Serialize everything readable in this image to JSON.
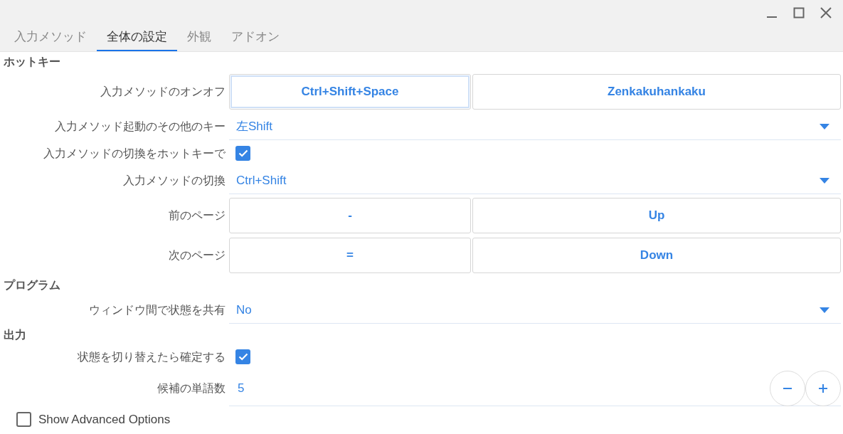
{
  "tabs": [
    {
      "label": "入力メソッド",
      "selected": false
    },
    {
      "label": "全体の設定",
      "selected": true
    },
    {
      "label": "外観",
      "selected": false
    },
    {
      "label": "アドオン",
      "selected": false
    }
  ],
  "sections": [
    {
      "title": "ホットキー",
      "rows": [
        {
          "kind": "keys",
          "label": "入力メソッドのオンオフ",
          "keys": [
            {
              "text": "Ctrl+Shift+Space",
              "focused": true
            },
            {
              "text": "Zenkakuhankaku",
              "focused": false
            }
          ]
        },
        {
          "kind": "select",
          "label": "入力メソッド起動のその他のキー",
          "value": "左Shift"
        },
        {
          "kind": "checkbox",
          "label": "入力メソッドの切換をホットキーで",
          "checked": true
        },
        {
          "kind": "select",
          "label": "入力メソッドの切換",
          "value": "Ctrl+Shift"
        },
        {
          "kind": "keys",
          "label": "前のページ",
          "keys": [
            {
              "text": "-",
              "focused": false
            },
            {
              "text": "Up",
              "focused": false
            }
          ]
        },
        {
          "kind": "keys",
          "label": "次のページ",
          "keys": [
            {
              "text": "=",
              "focused": false
            },
            {
              "text": "Down",
              "focused": false
            }
          ]
        }
      ]
    },
    {
      "title": "プログラム",
      "rows": [
        {
          "kind": "select",
          "label": "ウィンドウ間で状態を共有",
          "value": "No"
        }
      ]
    },
    {
      "title": "出力",
      "rows": [
        {
          "kind": "checkbox",
          "label": "状態を切り替えたら確定する",
          "checked": true
        },
        {
          "kind": "spin",
          "label": "候補の単語数",
          "value": "5"
        }
      ]
    }
  ],
  "advanced": {
    "label": "Show Advanced Options",
    "checked": false
  }
}
